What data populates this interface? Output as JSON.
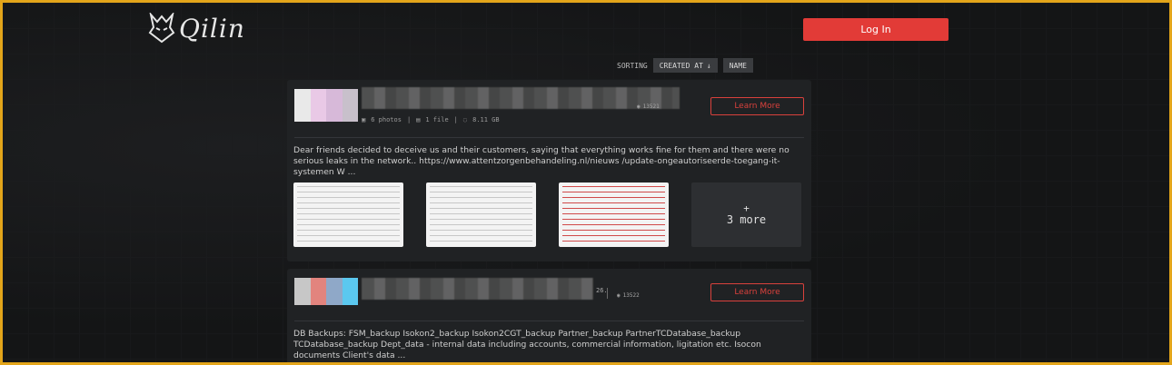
{
  "header": {
    "logo_text": "Qilin",
    "login_label": "Log In"
  },
  "sorting": {
    "label": "SORTING",
    "created_at": "CREATED AT",
    "created_at_arrow": "↓",
    "name": "NAME"
  },
  "posts": [
    {
      "photos": "6 photos",
      "files": "1 file",
      "size": "8.11 GB",
      "views": "13521",
      "learn_more": "Learn More",
      "description": "Dear friends decided to deceive us and their customers, saying that everything works fine for them and there were no serious leaks in the network.. https://www.attentzorgenbehandeling.nl/nieuws /update-ongeautoriseerde-toegang-it-systemen W ...",
      "more_plus": "+",
      "more_label": "3 more"
    },
    {
      "title_tail": "26.",
      "views": "13522",
      "learn_more": "Learn More",
      "description": "DB Backups: FSM_backup Isokon2_backup Isokon2CGT_backup Partner_backup PartnerTCDatabase_backup TCDatabase_backup Dept_data - internal data including accounts, commercial information, ligitation etc. Isocon documents Client's data ..."
    }
  ],
  "colors": {
    "accent": "#e23b37",
    "frame": "#e3a51a",
    "card": "#202224",
    "background": "#151617"
  }
}
